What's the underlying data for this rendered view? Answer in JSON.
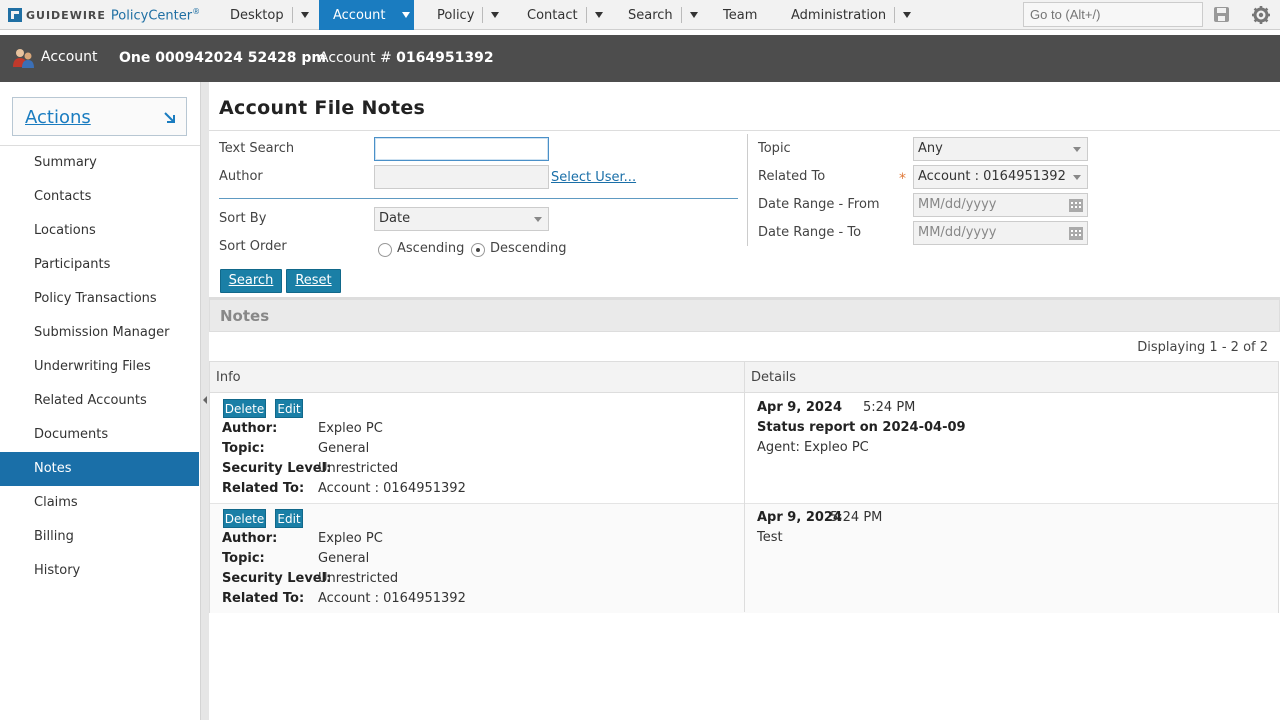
{
  "topnav": {
    "logo_brand": "GUIDEWIRE",
    "logo_product": "PolicyCenter",
    "logo_reg": "®",
    "items": [
      {
        "label": "Desktop"
      },
      {
        "label": "Account"
      },
      {
        "label": "Policy"
      },
      {
        "label": "Contact"
      },
      {
        "label": "Search"
      },
      {
        "label": "Team"
      },
      {
        "label": "Administration"
      }
    ],
    "goto_placeholder": "Go to (Alt+/)"
  },
  "header": {
    "account_label": "Account",
    "account_name": "One 000942024 52428 pm",
    "account_num_label": "Account #",
    "account_num": "0164951392"
  },
  "sidebar": {
    "actions_label": "Actions",
    "items": [
      {
        "label": "Summary"
      },
      {
        "label": "Contacts"
      },
      {
        "label": "Locations"
      },
      {
        "label": "Participants"
      },
      {
        "label": "Policy Transactions"
      },
      {
        "label": "Submission Manager"
      },
      {
        "label": "Underwriting Files"
      },
      {
        "label": "Related Accounts"
      },
      {
        "label": "Documents"
      },
      {
        "label": "Notes"
      },
      {
        "label": "Claims"
      },
      {
        "label": "Billing"
      },
      {
        "label": "History"
      }
    ],
    "active_index": 9
  },
  "main": {
    "title": "Account File Notes",
    "search": {
      "text_search_label": "Text Search",
      "text_search_value": "",
      "author_label": "Author",
      "author_value": "",
      "select_user_link": "Select User...",
      "sort_by_label": "Sort By",
      "sort_by_value": "Date",
      "sort_order_label": "Sort Order",
      "ascending_label": "Ascending",
      "descending_label": "Descending",
      "sort_order_selected": "Descending",
      "topic_label": "Topic",
      "topic_value": "Any",
      "related_to_label": "Related To",
      "related_to_value": "Account : 0164951392",
      "date_from_label": "Date Range - From",
      "date_to_label": "Date Range - To",
      "date_placeholder": "MM/dd/yyyy",
      "search_button": "Search",
      "reset_button": "Reset"
    },
    "notes": {
      "section_title": "Notes",
      "displaying": "Displaying 1 - 2 of 2",
      "col_info": "Info",
      "col_details": "Details",
      "delete_label": "Delete",
      "edit_label": "Edit",
      "author_key": "Author:",
      "topic_key": "Topic:",
      "security_key": "Security Level:",
      "related_key": "Related To:",
      "rows": [
        {
          "author": "Expleo PC",
          "topic": "General",
          "security": "Unrestricted",
          "related": "Account : 0164951392",
          "date": "Apr 9, 2024",
          "time": "5:24 PM",
          "subject": "Status report on 2024-04-09",
          "body": "Agent: Expleo PC"
        },
        {
          "author": "Expleo PC",
          "topic": "General",
          "security": "Unrestricted",
          "related": "Account : 0164951392",
          "date": "Apr 9, 2024",
          "time": "5:24 PM",
          "subject": "",
          "body": "Test"
        }
      ]
    }
  },
  "colors": {
    "accent": "#1a7cc0",
    "header_bg": "#4d4d4d",
    "button": "#1a7fa6",
    "active_side": "#1a6fa8"
  }
}
